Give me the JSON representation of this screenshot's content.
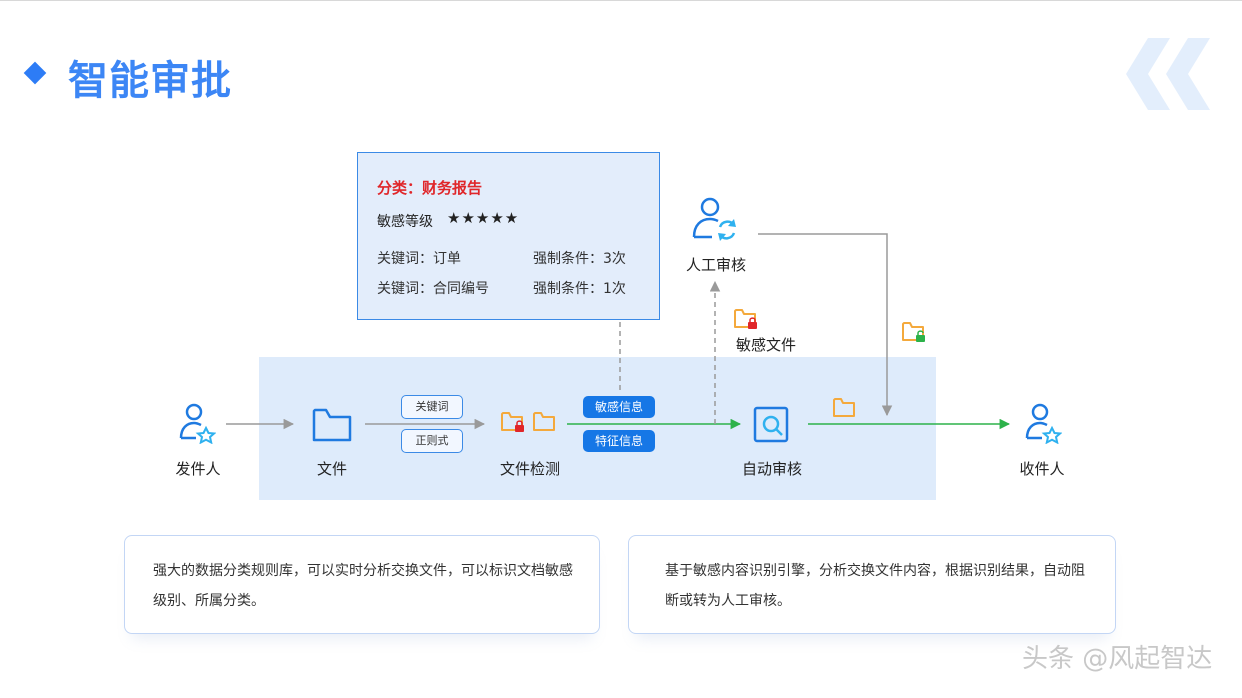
{
  "header": {
    "title": "智能审批"
  },
  "info_box": {
    "category": "分类：财务报告",
    "level_label": "敏感等级",
    "stars": "★★★★★",
    "rows": [
      {
        "keyword": "关键词：订单",
        "condition": "强制条件：3次"
      },
      {
        "keyword": "关键词：合同编号",
        "condition": "强制条件：1次"
      }
    ]
  },
  "nodes": {
    "sender": "发件人",
    "file": "文件",
    "file_check": "文件检测",
    "auto_review": "自动审核",
    "receiver": "收件人",
    "manual_review": "人工审核",
    "sensitive_file": "敏感文件"
  },
  "tags": {
    "keyword": "关键词",
    "regex": "正则式",
    "sensitive_info": "敏感信息",
    "feature_info": "特征信息"
  },
  "cards": [
    {
      "text": "强大的数据分类规则库，可以实时分析交换文件，可以标识文档敏感级别、所属分类。"
    },
    {
      "text": "基于敏感内容识别引擎，分析交换文件内容，根据识别结果，自动阻断或转为人工审核。"
    }
  ],
  "watermark": "头条 @风起智达",
  "colors": {
    "accent": "#2d7cf6",
    "band": "#deebfb",
    "alert": "#e0262a",
    "folder": "#f4a93c",
    "flow_green": "#2db24a"
  }
}
